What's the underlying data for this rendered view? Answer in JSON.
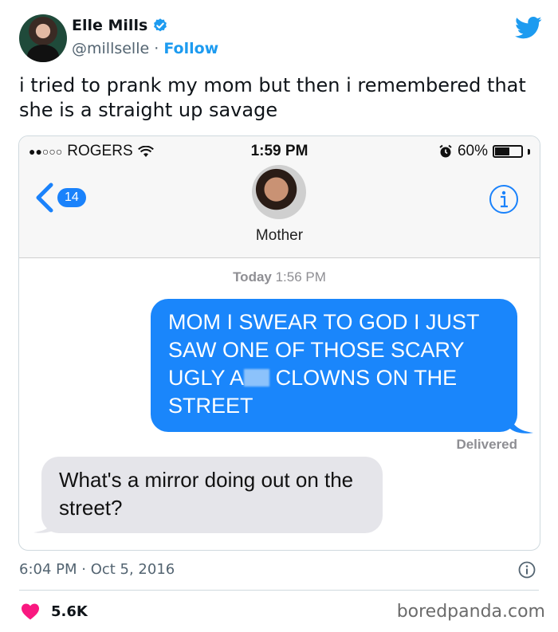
{
  "tweet": {
    "author_name": "Elle Mills",
    "handle": "@millselle",
    "separator": " · ",
    "follow_label": "Follow",
    "text": "i tried to prank my mom but then i remembered that she is a straight up savage",
    "timestamp": "6:04 PM · Oct 5, 2016",
    "like_count": "5.6K",
    "watermark": "boredpanda.com",
    "icons": [
      "verified-badge-icon",
      "twitter-bird-icon",
      "info-icon",
      "heart-icon"
    ],
    "colors": {
      "accent": "#1d9bf0",
      "like": "#f91880",
      "text": "#0f1419",
      "muted": "#536471"
    }
  },
  "phone": {
    "status": {
      "signal": "●●○○○",
      "carrier": "ROGERS",
      "time": "1:59 PM",
      "battery": "60%",
      "battery_level": 0.6
    },
    "nav": {
      "back_count": "14",
      "contact_name": "Mother"
    },
    "conversation": {
      "date_label": "Today",
      "date_time": " 1:56 PM",
      "sent": {
        "part1": "MOM I SWEAR TO GOD I JUST SAW ONE OF THOSE SCARY UGLY A",
        "part2": " CLOWNS ON THE STREET"
      },
      "delivered_label": "Delivered",
      "received": "What's a mirror doing out on the street?"
    },
    "colors": {
      "sent_bubble": "#1a86fb",
      "received_bubble": "#e5e5ea",
      "ios_blue": "#1a82fb"
    }
  }
}
